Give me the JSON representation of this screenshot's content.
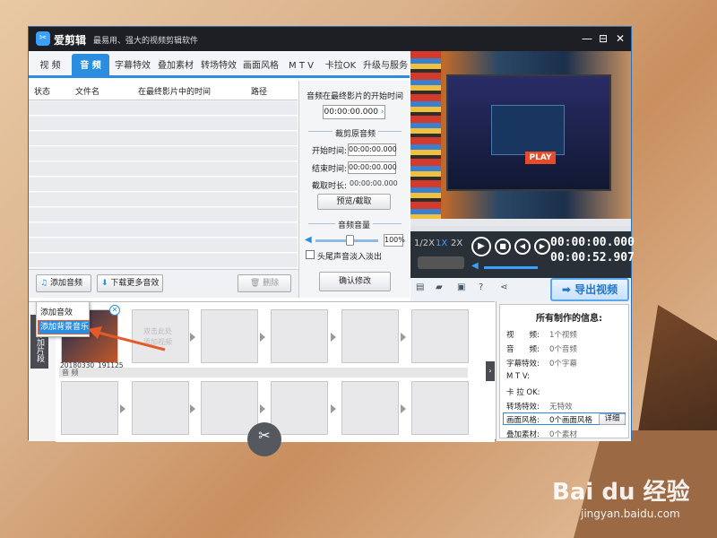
{
  "window": {
    "app_name": "爱剪辑",
    "slogan": "最易用、强大的视频剪辑软件",
    "minimize": "—",
    "maximize": "⊟",
    "close": "✕"
  },
  "tabs": [
    "视 频",
    "音 频",
    "字幕特效",
    "叠加素材",
    "转场特效",
    "画面风格",
    "M T V",
    "卡拉OK",
    "升级与服务"
  ],
  "active_tab": "音 频",
  "audio_table": {
    "columns": [
      "状态",
      "文件名",
      "在最终影片中的时间",
      "路径"
    ]
  },
  "control_panel": {
    "start_title": "音频在最终影片的开始时间",
    "start_value": "00:00:00.000",
    "trim_title": "裁剪原音频",
    "start_label": "开始时间:",
    "start_time": "00:00:00.000",
    "end_label": "结束时间:",
    "end_time": "00:00:00.000",
    "duration_label": "截取时长:",
    "duration_value": "00:00:00.000",
    "preview_button": "预览/截取",
    "volume_title": "音频音量",
    "volume_value": "100%",
    "fade_label": "头尾声音淡入淡出",
    "confirm_button": "确认修改"
  },
  "left_toolbar": {
    "add_audio": "添加音频",
    "download_more": "下载更多音效",
    "delete": "删除"
  },
  "dropdown": {
    "item1": "添加音效",
    "item2": "添加背景音乐"
  },
  "timeline": {
    "side_tab": "已添加片段",
    "clip_name": "20180330_191125",
    "drop_hint_line1": "双击此处",
    "drop_hint_line2": "添加视频",
    "audio_track_label": "音 频"
  },
  "player": {
    "speed_half": "1/2X",
    "speed_1x": "1X",
    "speed_2x": "2X",
    "current_time": "00:00:00.000",
    "total_time": "00:00:52.907",
    "export_button": "导出视频"
  },
  "preview_game": {
    "play_button": "PLAY"
  },
  "info_panel": {
    "title": "所有制作的信息:",
    "rows": [
      {
        "label": "视　　频:",
        "value": "1个视频"
      },
      {
        "label": "音　　频:",
        "value": "0个音频"
      },
      {
        "label": "字幕特效:",
        "value": "0个字幕"
      },
      {
        "label": "M  T  V:",
        "value": ""
      },
      {
        "label": "卡 拉 OK:",
        "value": ""
      },
      {
        "label": "转场特效:",
        "value": "无特效"
      },
      {
        "label": "画面风格:",
        "value": "0个画面风格"
      },
      {
        "label": "叠加素材:",
        "value": "0个素材"
      }
    ],
    "detail_button": "详细"
  },
  "watermark": {
    "brand": "Bai du 经验",
    "url": "jingyan.baidu.com"
  },
  "colors": {
    "accent": "#2a8de0",
    "titlebar": "#1d1f24",
    "highlight": "#e55a2b"
  }
}
